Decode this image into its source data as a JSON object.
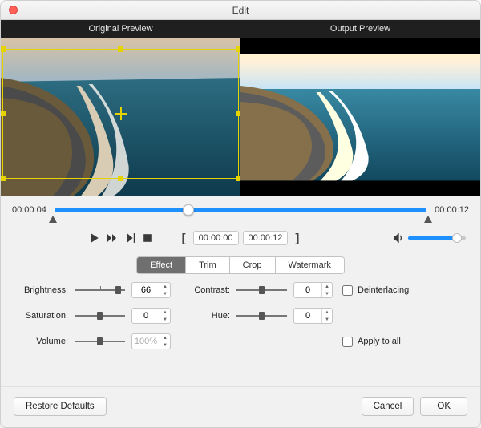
{
  "window": {
    "title": "Edit"
  },
  "preview": {
    "original_label": "Original Preview",
    "output_label": "Output Preview"
  },
  "timeline": {
    "current": "00:00:04",
    "total": "00:00:12",
    "playhead_pct": 36
  },
  "transport": {
    "range_start": "00:00:00",
    "range_end": "00:00:12",
    "volume_pct": 85
  },
  "tabs": {
    "effect": "Effect",
    "trim": "Trim",
    "crop": "Crop",
    "watermark": "Watermark",
    "active": "effect"
  },
  "effect": {
    "brightness": {
      "label": "Brightness:",
      "value": "66",
      "slider_pct": 88
    },
    "contrast": {
      "label": "Contrast:",
      "value": "0",
      "slider_pct": 50
    },
    "saturation": {
      "label": "Saturation:",
      "value": "0",
      "slider_pct": 50
    },
    "hue": {
      "label": "Hue:",
      "value": "0",
      "slider_pct": 50
    },
    "volume": {
      "label": "Volume:",
      "value": "100%",
      "slider_pct": 50
    },
    "deinterlacing": {
      "label": "Deinterlacing",
      "checked": false
    },
    "apply_all": {
      "label": "Apply to all",
      "checked": false
    }
  },
  "footer": {
    "restore": "Restore Defaults",
    "cancel": "Cancel",
    "ok": "OK"
  }
}
